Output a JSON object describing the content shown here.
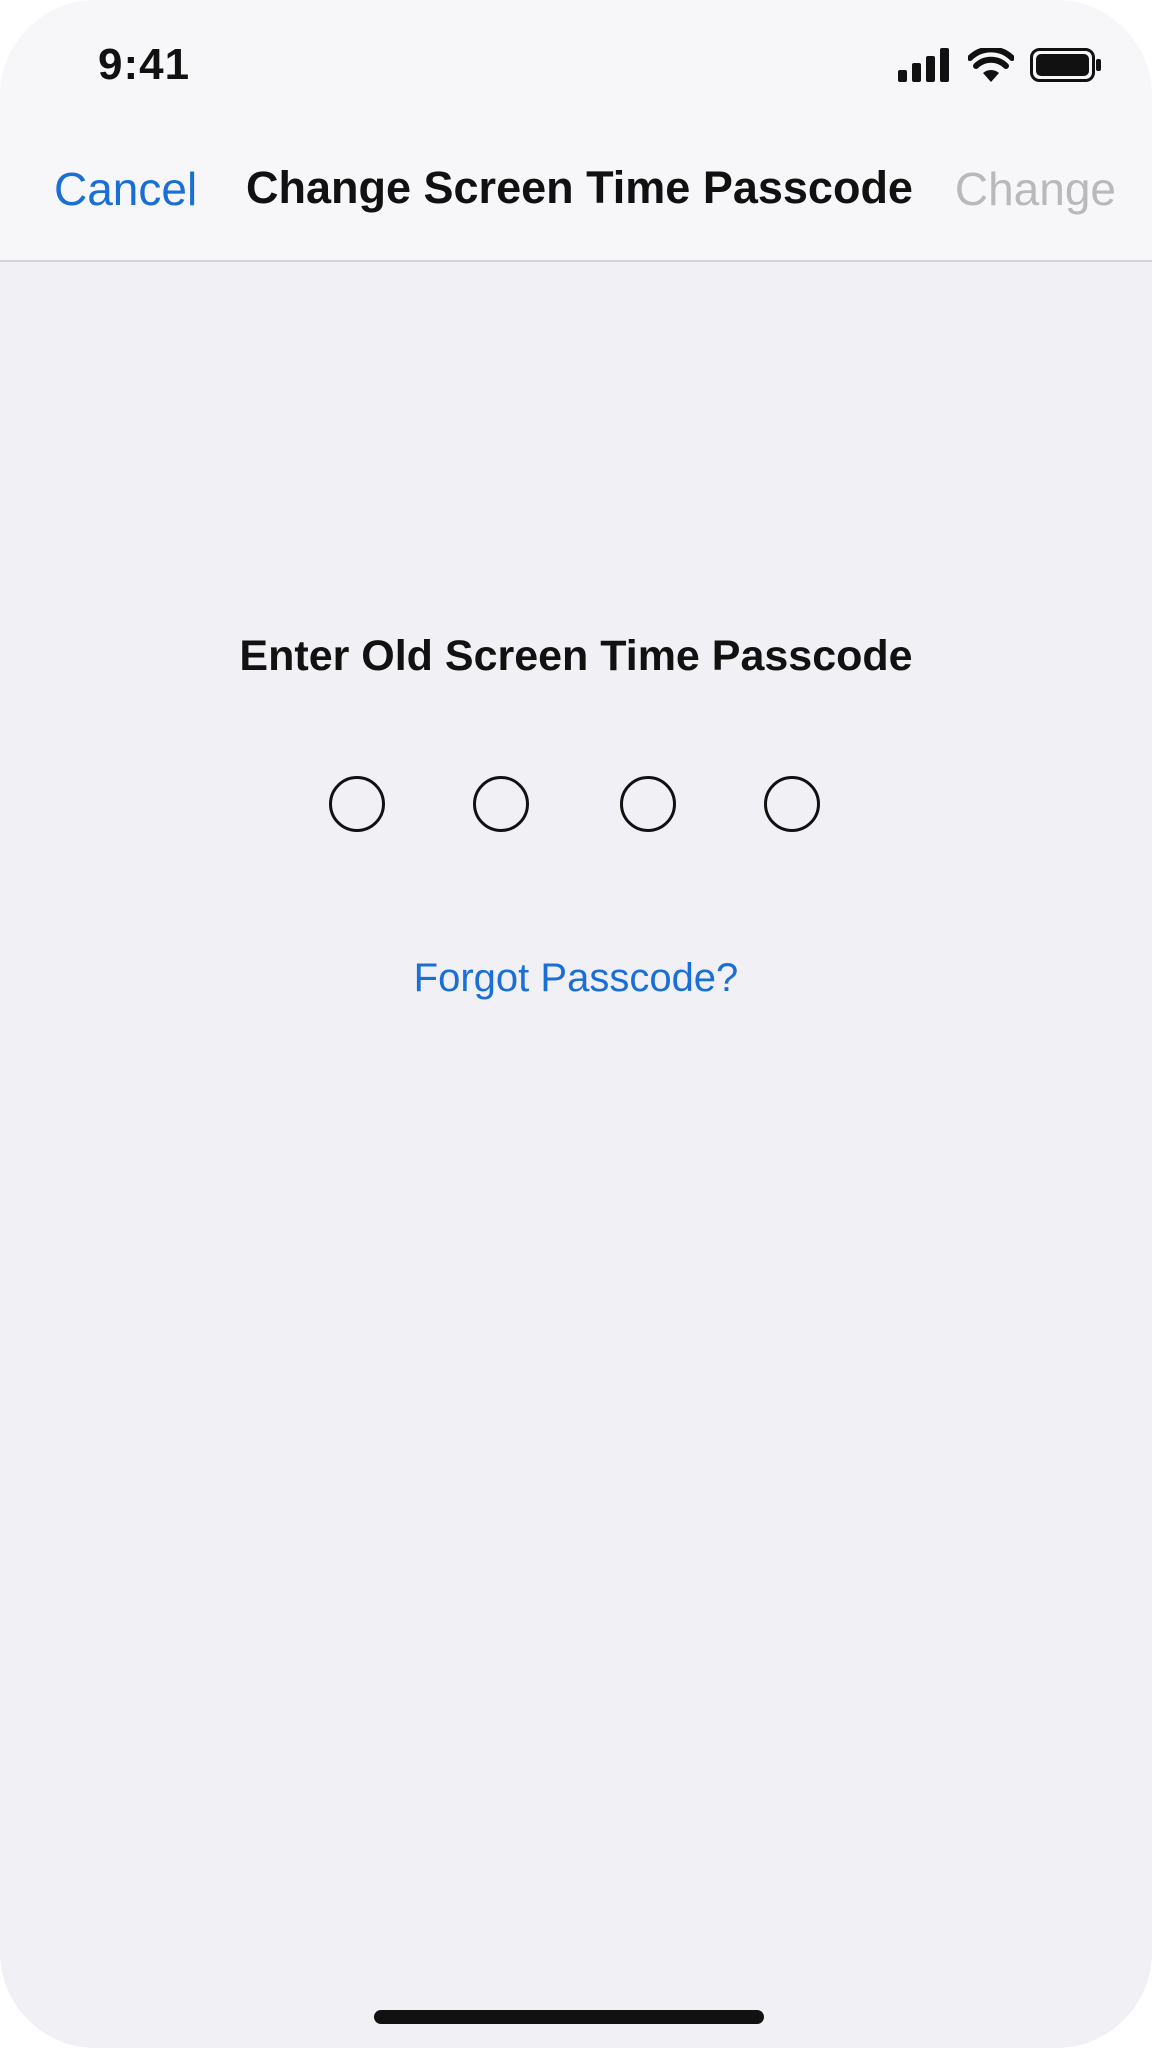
{
  "status_bar": {
    "time": "9:41",
    "icons": [
      "cellular-signal-icon",
      "wifi-icon",
      "battery-icon"
    ]
  },
  "nav": {
    "cancel_label": "Cancel",
    "title": "Change Screen Time Passcode",
    "change_label": "Change"
  },
  "passcode": {
    "prompt": "Enter Old Screen Time Passcode",
    "digits_total": 4,
    "digits_entered": 0,
    "forgot_label": "Forgot Passcode?"
  },
  "colors": {
    "accent": "#1a6fd6",
    "disabled": "#b9b9bd",
    "background": "#f0f0f5",
    "nav_background": "#f7f7f9"
  }
}
